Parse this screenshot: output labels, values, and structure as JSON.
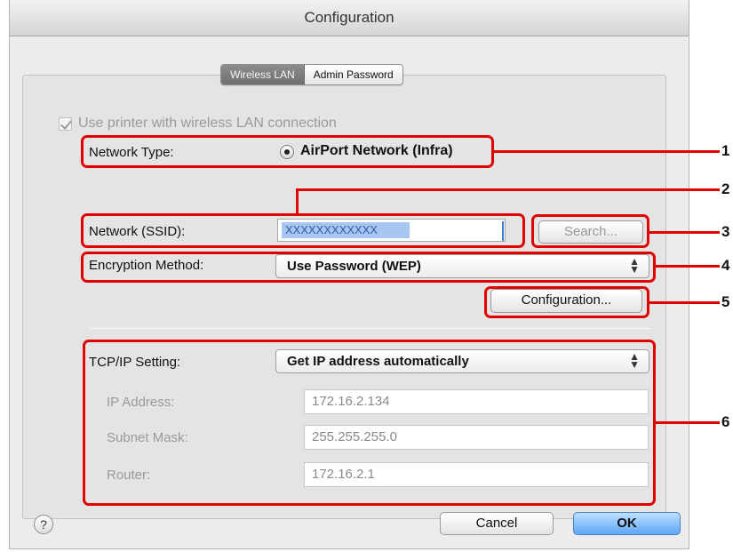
{
  "window": {
    "title": "Configuration"
  },
  "tabs": [
    {
      "label": "Wireless LAN"
    },
    {
      "label": "Admin Password"
    }
  ],
  "wireless": {
    "use_checkbox_label": "Use printer with wireless LAN connection",
    "network_type_label": "Network Type:",
    "network_type_value": "AirPort Network (Infra)",
    "ssid_label": "Network (SSID):",
    "ssid_value": "XXXXXXXXXXXX",
    "search_button": "Search...",
    "encryption_label": "Encryption Method:",
    "encryption_value": "Use Password (WEP)",
    "configuration_button": "Configuration..."
  },
  "tcpip": {
    "setting_label": "TCP/IP Setting:",
    "setting_value": "Get IP address automatically",
    "ip_label": "IP Address:",
    "ip_value": "172.16.2.134",
    "subnet_label": "Subnet Mask:",
    "subnet_value": "255.255.255.0",
    "router_label": "Router:",
    "router_value": "172.16.2.1"
  },
  "footer": {
    "help": "?",
    "cancel": "Cancel",
    "ok": "OK"
  },
  "callouts": [
    "1",
    "2",
    "3",
    "4",
    "5",
    "6"
  ],
  "colors": {
    "callout_red": "#e10000",
    "default_button_blue": "#5ea6f4"
  }
}
